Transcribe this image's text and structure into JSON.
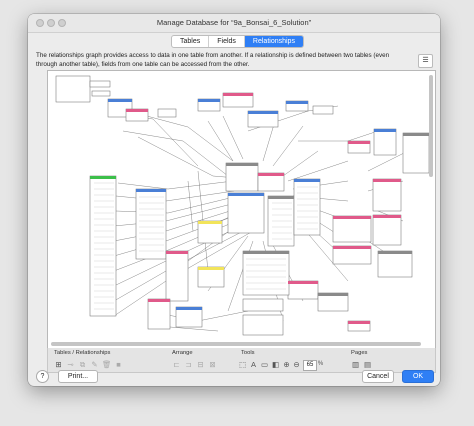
{
  "window": {
    "title": "Manage Database for “9a_Bonsai_6_Solution”"
  },
  "tabs": [
    {
      "label": "Tables",
      "active": false
    },
    {
      "label": "Fields",
      "active": false
    },
    {
      "label": "Relationships",
      "active": true
    }
  ],
  "description": "The relationships graph provides access to data in one table from another. If a relationship is defined between two tables (even through another table), fields from one table can be accessed from the other.",
  "toolbar": {
    "groups": {
      "tables_relationships": "Tables / Relationships",
      "arrange": "Arrange",
      "tools": "Tools",
      "pages": "Pages"
    },
    "zoom_value": "65",
    "zoom_unit": "%"
  },
  "footer": {
    "help_label": "?",
    "print_label": "Print...",
    "cancel_label": "Cancel",
    "ok_label": "OK"
  },
  "colors": {
    "accent": "#2f7ff5",
    "table_header_blue": "#4a7fd6",
    "table_header_pink": "#e05a8a",
    "table_header_green": "#3cbf4a",
    "table_header_yellow": "#f2e45a",
    "table_header_gray": "#8a8a8a"
  }
}
